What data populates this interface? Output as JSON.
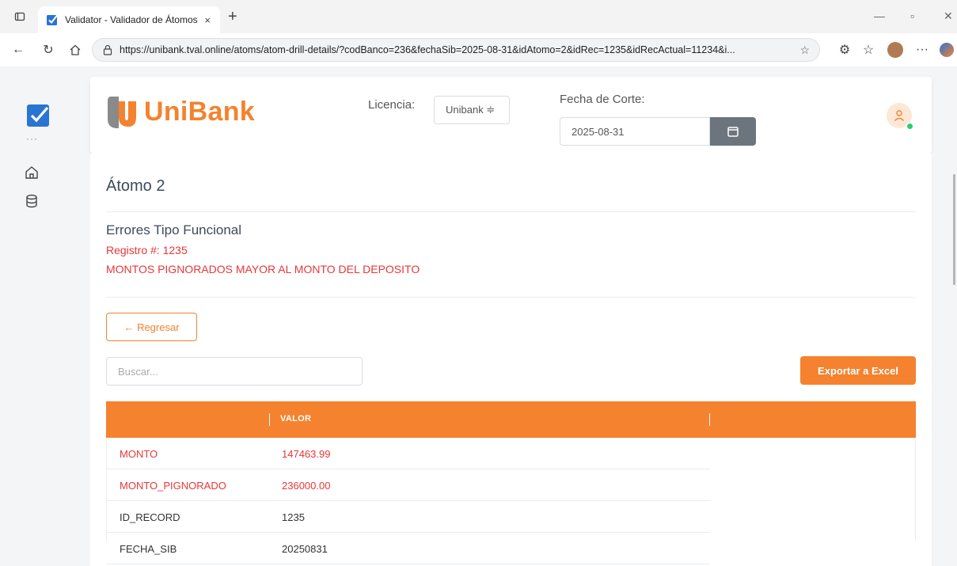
{
  "browser": {
    "tab_title": "Validator - Validador de Átomos",
    "tab_close": "×",
    "new_tab": "+",
    "url": "https://unibank.tval.online/atoms/atom-drill-details/?codBanco=236&fechaSib=2025-08-31&idAtomo=2&idRec=1235&idRecActual=11234&i...",
    "more": "···"
  },
  "sidebar": {
    "dots": "···"
  },
  "header": {
    "brand": "UniBank",
    "licencia_label": "Licencia:",
    "licencia_value": "Unibank ≑",
    "fecha_label": "Fecha de Corte:",
    "fecha_value": "2025-08-31"
  },
  "main": {
    "title": "Átomo 2",
    "error_type": "Errores Tipo Funcional",
    "registro": "Registro #: 1235",
    "error_message": "MONTOS PIGNORADOS MAYOR AL MONTO DEL DEPOSITO",
    "back_label": "← Regresar",
    "search_placeholder": "Buscar...",
    "export_label": "Exportar a Excel"
  },
  "table": {
    "columns": [
      "",
      "VALOR",
      ""
    ],
    "rows": [
      {
        "field": "MONTO",
        "value": "147463.99",
        "error": true
      },
      {
        "field": "MONTO_PIGNORADO",
        "value": "236000.00",
        "error": true
      },
      {
        "field": "ID_RECORD",
        "value": "1235",
        "error": false
      },
      {
        "field": "FECHA_SIB",
        "value": "20250831",
        "error": false
      }
    ]
  },
  "colors": {
    "accent": "#f4822e",
    "error": "#e8373a",
    "status_online": "#2ecc71"
  }
}
